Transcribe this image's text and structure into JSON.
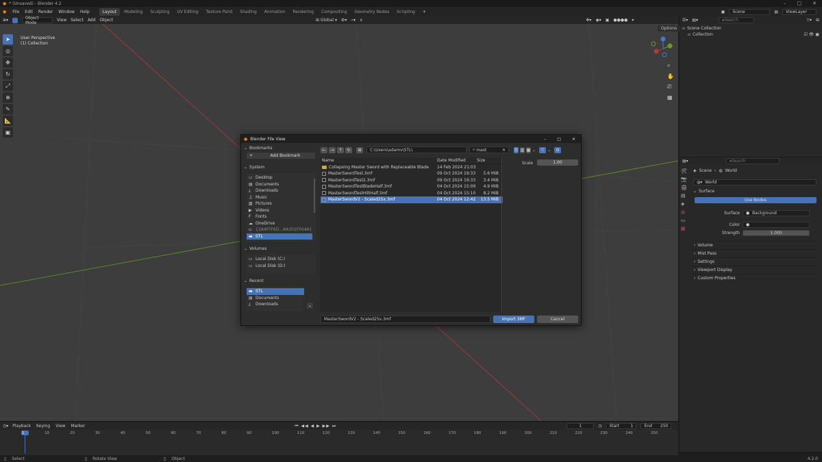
{
  "window": {
    "title": "* (Unsaved) - Blender 4.2",
    "version": "4.2.0"
  },
  "menus": [
    "File",
    "Edit",
    "Render",
    "Window",
    "Help"
  ],
  "workspaces": [
    "Layout",
    "Modeling",
    "Sculpting",
    "UV Editing",
    "Texture Paint",
    "Shading",
    "Animation",
    "Rendering",
    "Compositing",
    "Geometry Nodes",
    "Scripting"
  ],
  "active_workspace": "Layout",
  "topright": {
    "scene": "Scene",
    "view_layer": "ViewLayer"
  },
  "viewport_header": {
    "mode": "Object Mode",
    "items": [
      "View",
      "Select",
      "Add",
      "Object"
    ],
    "transform": "Global",
    "options": "Options"
  },
  "viewport_info": {
    "line1": "User Perspective",
    "line2": "(1) Collection"
  },
  "outliner": {
    "search_placeholder": "Search",
    "scene_collection": "Scene Collection",
    "collection": "Collection"
  },
  "properties": {
    "search_placeholder": "Search",
    "breadcrumb_scene": "Scene",
    "breadcrumb_world": "World",
    "world_name": "World",
    "surface_header": "Surface",
    "use_nodes": "Use Nodes",
    "surface_label": "Surface",
    "surface_value": "Background",
    "color_label": "Color",
    "strength_label": "Strength",
    "strength_value": "1.000",
    "sections": [
      "Volume",
      "Mist Pass",
      "Settings",
      "Viewport Display",
      "Custom Properties"
    ]
  },
  "timeline": {
    "menus": [
      "Playback",
      "Keying",
      "View",
      "Marker"
    ],
    "current_frame": "1",
    "start_label": "Start",
    "start": "1",
    "end_label": "End",
    "end": "250",
    "ticks": [
      "1",
      "10",
      "20",
      "30",
      "40",
      "50",
      "60",
      "70",
      "80",
      "90",
      "100",
      "110",
      "120",
      "130",
      "140",
      "150",
      "160",
      "170",
      "180",
      "190",
      "200",
      "210",
      "220",
      "230",
      "240",
      "250"
    ]
  },
  "statusbar": {
    "select": "Select",
    "rotate": "Rotate View",
    "object": "Object"
  },
  "dialog": {
    "title": "Blender File View",
    "bookmarks_header": "Bookmarks",
    "add_bookmark": "Add Bookmark",
    "system_header": "System",
    "system_items": [
      "Desktop",
      "Documents",
      "Downloads",
      "Music",
      "Pictures",
      "Videos",
      "Fonts",
      "OneDrive",
      "{2A4FFF6D...AA302FF64A}",
      "STL"
    ],
    "volumes_header": "Volumes",
    "volumes": [
      "Local Disk (C:)",
      "Local Disk (D:)"
    ],
    "recent_header": "Recent",
    "recent": [
      "STL",
      "Documents",
      "Downloads"
    ],
    "path": "C:\\Users\\adamv\\STL\\",
    "filter": "mast",
    "col_name": "Name",
    "col_date": "Date Modified",
    "col_size": "Size",
    "files": [
      {
        "name": "Collapsing Master Sword with Replaceable Blade",
        "date": "14 Feb 2024 21:03",
        "size": "",
        "folder": true
      },
      {
        "name": "MasterSwordTest.3mf",
        "date": "09 Oct 2024 19:33",
        "size": "5.6 MiB"
      },
      {
        "name": "MasterSwordTest2.3mf",
        "date": "09 Oct 2024 19:33",
        "size": "3.4 MiB"
      },
      {
        "name": "MasterSwordTestBladeHalf.3mf",
        "date": "04 Oct 2024 15:09",
        "size": "4.9 MiB"
      },
      {
        "name": "MasterSwordTestHiltHalf.3mf",
        "date": "04 Oct 2024 15:10",
        "size": "8.2 MiB"
      },
      {
        "name": "MasterSwordV2 - Scaled25x.3mf",
        "date": "04 Oct 2024 12:42",
        "size": "13.5 MiB",
        "selected": true
      }
    ],
    "scale_label": "Scale",
    "scale_value": "1.00",
    "filename": "MasterSwordV2 - Scaled25x.3mf",
    "import_label": "Import 3MF",
    "cancel_label": "Cancel"
  },
  "colors": {
    "accent": "#4772b3",
    "viewport": "#3d3d3d",
    "x_axis": "#b03a3a",
    "y_axis": "#6a9a2a"
  }
}
